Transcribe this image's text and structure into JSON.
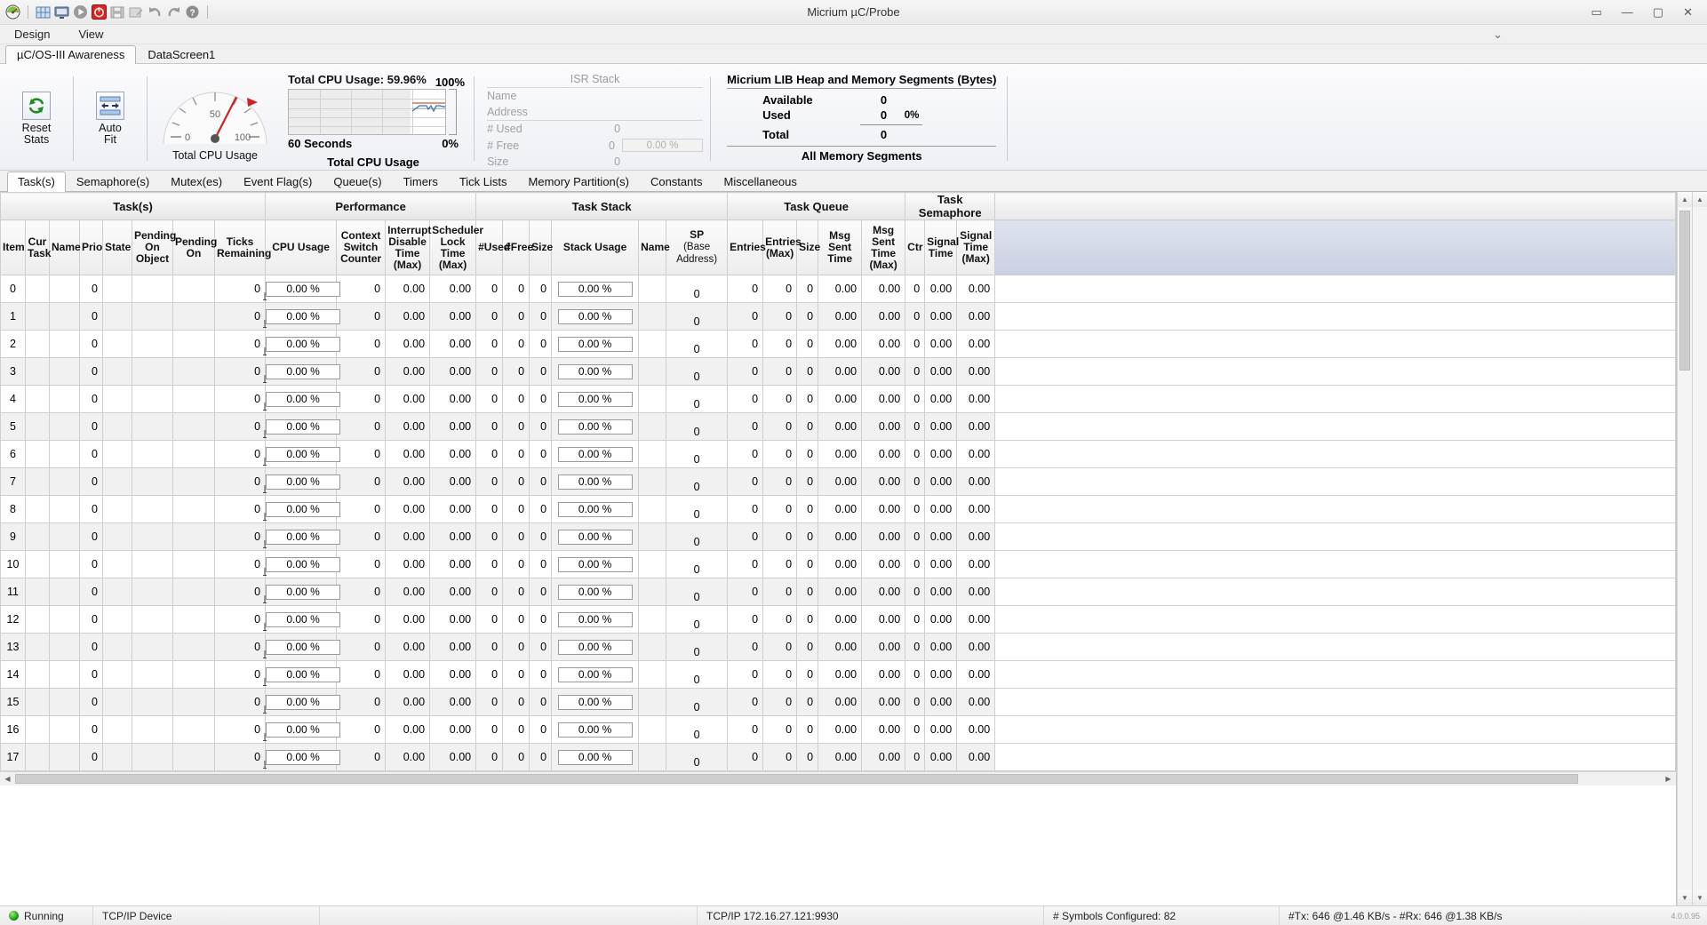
{
  "window": {
    "title": "Micrium µC/Probe",
    "minimize": "—",
    "maximize": "▢",
    "close": "✕",
    "help_glyph": "▭"
  },
  "toolbar": {
    "icons": [
      {
        "name": "probe-logo-icon",
        "glyph": "gauge"
      },
      {
        "name": "layout-grid-icon",
        "glyph": "grid"
      },
      {
        "name": "monitor-icon",
        "glyph": "monitor"
      },
      {
        "name": "run-icon",
        "glyph": "play"
      },
      {
        "name": "stop-icon",
        "glyph": "stop"
      },
      {
        "name": "save-icon",
        "glyph": "save"
      },
      {
        "name": "save-as-icon",
        "glyph": "saveas"
      },
      {
        "name": "undo-icon",
        "glyph": "undo"
      },
      {
        "name": "redo-icon",
        "glyph": "redo"
      },
      {
        "name": "help-icon",
        "glyph": "help"
      }
    ]
  },
  "menu": {
    "items": [
      "Design",
      "View"
    ]
  },
  "screen_tabs": {
    "items": [
      "µC/OS-III Awareness",
      "DataScreen1"
    ],
    "active": 0
  },
  "ribbon": {
    "reset_stats": "Reset\nStats",
    "reset_stats_line1": "Reset",
    "reset_stats_line2": "Stats",
    "auto_fit_line1": "Auto",
    "auto_fit_line2": "Fit",
    "gauge": {
      "caption": "Total CPU Usage",
      "min": "0",
      "mid": "50",
      "max": "100",
      "value": 59.96
    },
    "cpu_chart": {
      "title": "Total CPU Usage: 59.96%",
      "y_max": "100%",
      "y_min": "0%",
      "x_label": "60 Seconds",
      "bottom_label": "Total CPU Usage"
    },
    "isr_stack": {
      "header": "ISR Stack",
      "rows": [
        {
          "label": "Name",
          "value": ""
        },
        {
          "label": "Address",
          "value": ""
        },
        {
          "label": "# Used",
          "value": "0"
        },
        {
          "label": "# Free",
          "value": "0",
          "pct": "0.00 %"
        },
        {
          "label": "Size",
          "value": "0"
        }
      ]
    },
    "heap": {
      "header": "Micrium LIB Heap and Memory Segments (Bytes)",
      "rows": [
        {
          "label": "Available",
          "value": "0"
        },
        {
          "label": "Used",
          "value": "0"
        },
        {
          "label": "Total",
          "value": "0"
        }
      ],
      "percent": "0%",
      "footer": "All Memory Segments"
    }
  },
  "object_tabs": {
    "items": [
      "Task(s)",
      "Semaphore(s)",
      "Mutex(es)",
      "Event Flag(s)",
      "Queue(s)",
      "Timers",
      "Tick Lists",
      "Memory Partition(s)",
      "Constants",
      "Miscellaneous"
    ],
    "active": 0
  },
  "grid": {
    "groups": [
      {
        "label": "Task(s)",
        "span": 9
      },
      {
        "label": "Performance",
        "span": 4
      },
      {
        "label": "Task Stack",
        "span": 6
      },
      {
        "label": "Task Queue",
        "span": 5
      },
      {
        "label": "Task Semaphore",
        "span": 3
      },
      {
        "label": "",
        "span": 1
      }
    ],
    "columns": [
      {
        "label": "Item",
        "sub": ""
      },
      {
        "label": "Cur Task",
        "sub": ""
      },
      {
        "label": "Name",
        "sub": ""
      },
      {
        "label": "Prio",
        "sub": ""
      },
      {
        "label": "State",
        "sub": ""
      },
      {
        "label": "Pending On Object",
        "sub": ""
      },
      {
        "label": "Pending On",
        "sub": ""
      },
      {
        "label": "Ticks Remaining",
        "sub": ""
      },
      {
        "label": "CPU Usage",
        "sub": ""
      },
      {
        "label": "Context Switch Counter",
        "sub": ""
      },
      {
        "label": "Interrupt Disable Time (Max)",
        "sub": ""
      },
      {
        "label": "Scheduler Lock Time (Max)",
        "sub": ""
      },
      {
        "label": "#Used",
        "sub": ""
      },
      {
        "label": "#Free",
        "sub": ""
      },
      {
        "label": "Size",
        "sub": ""
      },
      {
        "label": "Stack Usage",
        "sub": ""
      },
      {
        "label": "Name",
        "sub": ""
      },
      {
        "label": "SP",
        "sub": "(Base Address)"
      },
      {
        "label": "Entries",
        "sub": ""
      },
      {
        "label": "Entries (Max)",
        "sub": ""
      },
      {
        "label": "Size",
        "sub": ""
      },
      {
        "label": "Msg Sent Time",
        "sub": ""
      },
      {
        "label": "Msg Sent Time (Max)",
        "sub": ""
      },
      {
        "label": "Ctr",
        "sub": ""
      },
      {
        "label": "Signal Time",
        "sub": ""
      },
      {
        "label": "Signal Time (Max)",
        "sub": ""
      },
      {
        "label": "",
        "sub": ""
      }
    ],
    "rows": [
      {
        "item": "0",
        "cur_task": "",
        "name": "",
        "prio": "0",
        "state": "",
        "pend_obj": "",
        "pend_on": "",
        "ticks": "0",
        "cpu": "0.00 %",
        "ctx": "0",
        "int_dis": "0.00",
        "sched_lock": "0.00",
        "used": "0",
        "free": "0",
        "size": "0",
        "stack": "0.00 %",
        "q_name": "",
        "sp": "0",
        "entries": "0",
        "entries_max": "0",
        "q_size": "0",
        "msg_time": "0.00",
        "msg_time_max": "0.00",
        "ctr": "0",
        "sig_time": "0.00",
        "sig_time_max": "0.00"
      },
      {
        "item": "1",
        "cur_task": "",
        "name": "",
        "prio": "0",
        "state": "",
        "pend_obj": "",
        "pend_on": "",
        "ticks": "0",
        "cpu": "0.00 %",
        "ctx": "0",
        "int_dis": "0.00",
        "sched_lock": "0.00",
        "used": "0",
        "free": "0",
        "size": "0",
        "stack": "0.00 %",
        "q_name": "",
        "sp": "0",
        "entries": "0",
        "entries_max": "0",
        "q_size": "0",
        "msg_time": "0.00",
        "msg_time_max": "0.00",
        "ctr": "0",
        "sig_time": "0.00",
        "sig_time_max": "0.00"
      },
      {
        "item": "2",
        "cur_task": "",
        "name": "",
        "prio": "0",
        "state": "",
        "pend_obj": "",
        "pend_on": "",
        "ticks": "0",
        "cpu": "0.00 %",
        "ctx": "0",
        "int_dis": "0.00",
        "sched_lock": "0.00",
        "used": "0",
        "free": "0",
        "size": "0",
        "stack": "0.00 %",
        "q_name": "",
        "sp": "0",
        "entries": "0",
        "entries_max": "0",
        "q_size": "0",
        "msg_time": "0.00",
        "msg_time_max": "0.00",
        "ctr": "0",
        "sig_time": "0.00",
        "sig_time_max": "0.00"
      },
      {
        "item": "3",
        "cur_task": "",
        "name": "",
        "prio": "0",
        "state": "",
        "pend_obj": "",
        "pend_on": "",
        "ticks": "0",
        "cpu": "0.00 %",
        "ctx": "0",
        "int_dis": "0.00",
        "sched_lock": "0.00",
        "used": "0",
        "free": "0",
        "size": "0",
        "stack": "0.00 %",
        "q_name": "",
        "sp": "0",
        "entries": "0",
        "entries_max": "0",
        "q_size": "0",
        "msg_time": "0.00",
        "msg_time_max": "0.00",
        "ctr": "0",
        "sig_time": "0.00",
        "sig_time_max": "0.00"
      },
      {
        "item": "4",
        "cur_task": "",
        "name": "",
        "prio": "0",
        "state": "",
        "pend_obj": "",
        "pend_on": "",
        "ticks": "0",
        "cpu": "0.00 %",
        "ctx": "0",
        "int_dis": "0.00",
        "sched_lock": "0.00",
        "used": "0",
        "free": "0",
        "size": "0",
        "stack": "0.00 %",
        "q_name": "",
        "sp": "0",
        "entries": "0",
        "entries_max": "0",
        "q_size": "0",
        "msg_time": "0.00",
        "msg_time_max": "0.00",
        "ctr": "0",
        "sig_time": "0.00",
        "sig_time_max": "0.00"
      },
      {
        "item": "5",
        "cur_task": "",
        "name": "",
        "prio": "0",
        "state": "",
        "pend_obj": "",
        "pend_on": "",
        "ticks": "0",
        "cpu": "0.00 %",
        "ctx": "0",
        "int_dis": "0.00",
        "sched_lock": "0.00",
        "used": "0",
        "free": "0",
        "size": "0",
        "stack": "0.00 %",
        "q_name": "",
        "sp": "0",
        "entries": "0",
        "entries_max": "0",
        "q_size": "0",
        "msg_time": "0.00",
        "msg_time_max": "0.00",
        "ctr": "0",
        "sig_time": "0.00",
        "sig_time_max": "0.00"
      },
      {
        "item": "6",
        "cur_task": "",
        "name": "",
        "prio": "0",
        "state": "",
        "pend_obj": "",
        "pend_on": "",
        "ticks": "0",
        "cpu": "0.00 %",
        "ctx": "0",
        "int_dis": "0.00",
        "sched_lock": "0.00",
        "used": "0",
        "free": "0",
        "size": "0",
        "stack": "0.00 %",
        "q_name": "",
        "sp": "0",
        "entries": "0",
        "entries_max": "0",
        "q_size": "0",
        "msg_time": "0.00",
        "msg_time_max": "0.00",
        "ctr": "0",
        "sig_time": "0.00",
        "sig_time_max": "0.00"
      },
      {
        "item": "7",
        "cur_task": "",
        "name": "",
        "prio": "0",
        "state": "",
        "pend_obj": "",
        "pend_on": "",
        "ticks": "0",
        "cpu": "0.00 %",
        "ctx": "0",
        "int_dis": "0.00",
        "sched_lock": "0.00",
        "used": "0",
        "free": "0",
        "size": "0",
        "stack": "0.00 %",
        "q_name": "",
        "sp": "0",
        "entries": "0",
        "entries_max": "0",
        "q_size": "0",
        "msg_time": "0.00",
        "msg_time_max": "0.00",
        "ctr": "0",
        "sig_time": "0.00",
        "sig_time_max": "0.00"
      },
      {
        "item": "8",
        "cur_task": "",
        "name": "",
        "prio": "0",
        "state": "",
        "pend_obj": "",
        "pend_on": "",
        "ticks": "0",
        "cpu": "0.00 %",
        "ctx": "0",
        "int_dis": "0.00",
        "sched_lock": "0.00",
        "used": "0",
        "free": "0",
        "size": "0",
        "stack": "0.00 %",
        "q_name": "",
        "sp": "0",
        "entries": "0",
        "entries_max": "0",
        "q_size": "0",
        "msg_time": "0.00",
        "msg_time_max": "0.00",
        "ctr": "0",
        "sig_time": "0.00",
        "sig_time_max": "0.00"
      },
      {
        "item": "9",
        "cur_task": "",
        "name": "",
        "prio": "0",
        "state": "",
        "pend_obj": "",
        "pend_on": "",
        "ticks": "0",
        "cpu": "0.00 %",
        "ctx": "0",
        "int_dis": "0.00",
        "sched_lock": "0.00",
        "used": "0",
        "free": "0",
        "size": "0",
        "stack": "0.00 %",
        "q_name": "",
        "sp": "0",
        "entries": "0",
        "entries_max": "0",
        "q_size": "0",
        "msg_time": "0.00",
        "msg_time_max": "0.00",
        "ctr": "0",
        "sig_time": "0.00",
        "sig_time_max": "0.00"
      },
      {
        "item": "10",
        "cur_task": "",
        "name": "",
        "prio": "0",
        "state": "",
        "pend_obj": "",
        "pend_on": "",
        "ticks": "0",
        "cpu": "0.00 %",
        "ctx": "0",
        "int_dis": "0.00",
        "sched_lock": "0.00",
        "used": "0",
        "free": "0",
        "size": "0",
        "stack": "0.00 %",
        "q_name": "",
        "sp": "0",
        "entries": "0",
        "entries_max": "0",
        "q_size": "0",
        "msg_time": "0.00",
        "msg_time_max": "0.00",
        "ctr": "0",
        "sig_time": "0.00",
        "sig_time_max": "0.00"
      },
      {
        "item": "11",
        "cur_task": "",
        "name": "",
        "prio": "0",
        "state": "",
        "pend_obj": "",
        "pend_on": "",
        "ticks": "0",
        "cpu": "0.00 %",
        "ctx": "0",
        "int_dis": "0.00",
        "sched_lock": "0.00",
        "used": "0",
        "free": "0",
        "size": "0",
        "stack": "0.00 %",
        "q_name": "",
        "sp": "0",
        "entries": "0",
        "entries_max": "0",
        "q_size": "0",
        "msg_time": "0.00",
        "msg_time_max": "0.00",
        "ctr": "0",
        "sig_time": "0.00",
        "sig_time_max": "0.00"
      },
      {
        "item": "12",
        "cur_task": "",
        "name": "",
        "prio": "0",
        "state": "",
        "pend_obj": "",
        "pend_on": "",
        "ticks": "0",
        "cpu": "0.00 %",
        "ctx": "0",
        "int_dis": "0.00",
        "sched_lock": "0.00",
        "used": "0",
        "free": "0",
        "size": "0",
        "stack": "0.00 %",
        "q_name": "",
        "sp": "0",
        "entries": "0",
        "entries_max": "0",
        "q_size": "0",
        "msg_time": "0.00",
        "msg_time_max": "0.00",
        "ctr": "0",
        "sig_time": "0.00",
        "sig_time_max": "0.00"
      },
      {
        "item": "13",
        "cur_task": "",
        "name": "",
        "prio": "0",
        "state": "",
        "pend_obj": "",
        "pend_on": "",
        "ticks": "0",
        "cpu": "0.00 %",
        "ctx": "0",
        "int_dis": "0.00",
        "sched_lock": "0.00",
        "used": "0",
        "free": "0",
        "size": "0",
        "stack": "0.00 %",
        "q_name": "",
        "sp": "0",
        "entries": "0",
        "entries_max": "0",
        "q_size": "0",
        "msg_time": "0.00",
        "msg_time_max": "0.00",
        "ctr": "0",
        "sig_time": "0.00",
        "sig_time_max": "0.00"
      },
      {
        "item": "14",
        "cur_task": "",
        "name": "",
        "prio": "0",
        "state": "",
        "pend_obj": "",
        "pend_on": "",
        "ticks": "0",
        "cpu": "0.00 %",
        "ctx": "0",
        "int_dis": "0.00",
        "sched_lock": "0.00",
        "used": "0",
        "free": "0",
        "size": "0",
        "stack": "0.00 %",
        "q_name": "",
        "sp": "0",
        "entries": "0",
        "entries_max": "0",
        "q_size": "0",
        "msg_time": "0.00",
        "msg_time_max": "0.00",
        "ctr": "0",
        "sig_time": "0.00",
        "sig_time_max": "0.00"
      },
      {
        "item": "15",
        "cur_task": "",
        "name": "",
        "prio": "0",
        "state": "",
        "pend_obj": "",
        "pend_on": "",
        "ticks": "0",
        "cpu": "0.00 %",
        "ctx": "0",
        "int_dis": "0.00",
        "sched_lock": "0.00",
        "used": "0",
        "free": "0",
        "size": "0",
        "stack": "0.00 %",
        "q_name": "",
        "sp": "0",
        "entries": "0",
        "entries_max": "0",
        "q_size": "0",
        "msg_time": "0.00",
        "msg_time_max": "0.00",
        "ctr": "0",
        "sig_time": "0.00",
        "sig_time_max": "0.00"
      },
      {
        "item": "16",
        "cur_task": "",
        "name": "",
        "prio": "0",
        "state": "",
        "pend_obj": "",
        "pend_on": "",
        "ticks": "0",
        "cpu": "0.00 %",
        "ctx": "0",
        "int_dis": "0.00",
        "sched_lock": "0.00",
        "used": "0",
        "free": "0",
        "size": "0",
        "stack": "0.00 %",
        "q_name": "",
        "sp": "0",
        "entries": "0",
        "entries_max": "0",
        "q_size": "0",
        "msg_time": "0.00",
        "msg_time_max": "0.00",
        "ctr": "0",
        "sig_time": "0.00",
        "sig_time_max": "0.00"
      },
      {
        "item": "17",
        "cur_task": "",
        "name": "",
        "prio": "0",
        "state": "",
        "pend_obj": "",
        "pend_on": "",
        "ticks": "0",
        "cpu": "0.00 %",
        "ctx": "0",
        "int_dis": "0.00",
        "sched_lock": "0.00",
        "used": "0",
        "free": "0",
        "size": "0",
        "stack": "0.00 %",
        "q_name": "",
        "sp": "0",
        "entries": "0",
        "entries_max": "0",
        "q_size": "0",
        "msg_time": "0.00",
        "msg_time_max": "0.00",
        "ctr": "0",
        "sig_time": "0.00",
        "sig_time_max": "0.00"
      }
    ]
  },
  "statusbar": {
    "state": "Running",
    "device": "TCP/IP Device",
    "connection": "TCP/IP 172.16.27.121:9930",
    "symbols": "# Symbols Configured:  82",
    "traffic": "#Tx: 646 @1.46 KB/s - #Rx: 646 @1.38 KB/s",
    "version": "4.0.0.95"
  },
  "colors": {
    "accent_red": "#cc2222",
    "accent_green": "#1d8b1d",
    "chart_blue": "#3a6fb0",
    "chart_orange": "#c4622d"
  }
}
